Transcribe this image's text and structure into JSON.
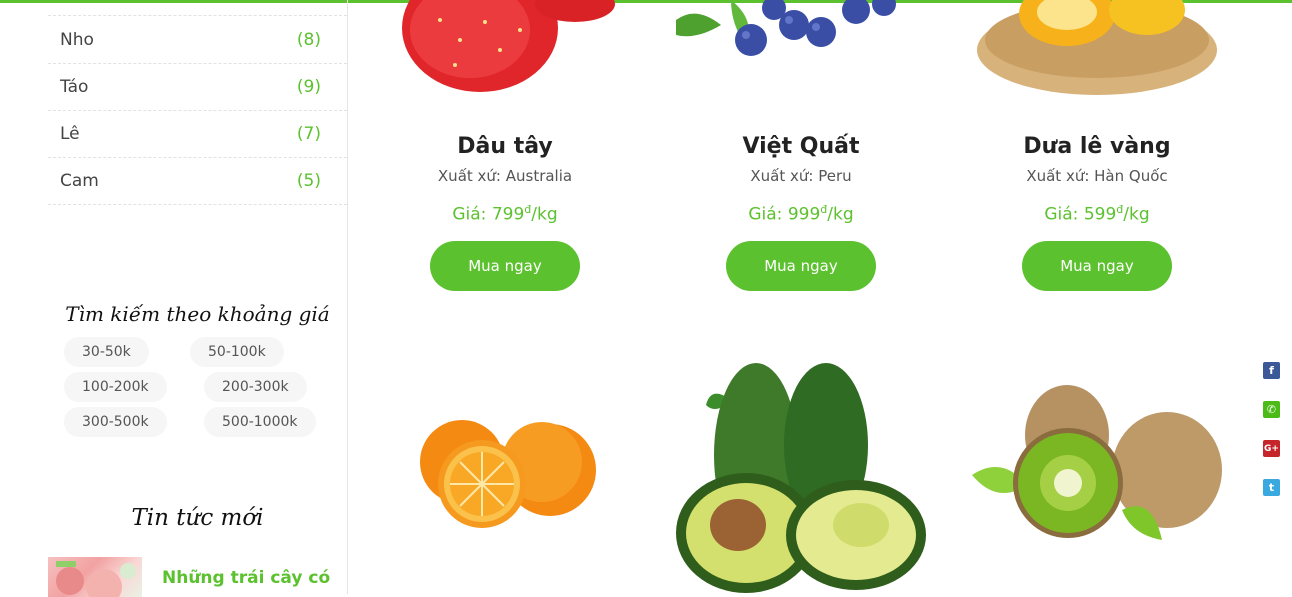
{
  "categories": [
    {
      "label": "Nho",
      "count": "(8)"
    },
    {
      "label": "Táo",
      "count": "(9)"
    },
    {
      "label": "Lê",
      "count": "(7)"
    },
    {
      "label": "Cam",
      "count": "(5)"
    }
  ],
  "price_filter": {
    "title": "Tìm kiếm theo khoảng giá",
    "ranges": [
      "30-50k",
      "50-100k",
      "100-200k",
      "200-300k",
      "300-500k",
      "500-1000k"
    ]
  },
  "news": {
    "title": "Tin tức mới",
    "first_item": "Những trái cây có"
  },
  "products": [
    {
      "name": "Dâu tây",
      "origin": "Xuất xứ: Australia",
      "price_label": "Giá: ",
      "price": "799",
      "currency": "đ",
      "unit": "/kg",
      "button": "Mua ngay"
    },
    {
      "name": "Việt Quất",
      "origin": "Xuất xứ: Peru",
      "price_label": "Giá: ",
      "price": "999",
      "currency": "đ",
      "unit": "/kg",
      "button": "Mua ngay"
    },
    {
      "name": "Dưa lê vàng",
      "origin": "Xuất xứ: Hàn Quốc",
      "price_label": "Giá: ",
      "price": "599",
      "currency": "đ",
      "unit": "/kg",
      "button": "Mua ngay"
    }
  ],
  "social": [
    {
      "icon": "facebook-icon",
      "glyph": "f",
      "color": "#3b5998"
    },
    {
      "icon": "phone-icon",
      "glyph": "✆",
      "color": "#4cbb17"
    },
    {
      "icon": "google-plus-icon",
      "glyph": "G+",
      "color": "#c4262a"
    },
    {
      "icon": "twitter-icon",
      "glyph": "t",
      "color": "#39a9e0"
    }
  ],
  "colors": {
    "accent": "#5cc12f"
  }
}
